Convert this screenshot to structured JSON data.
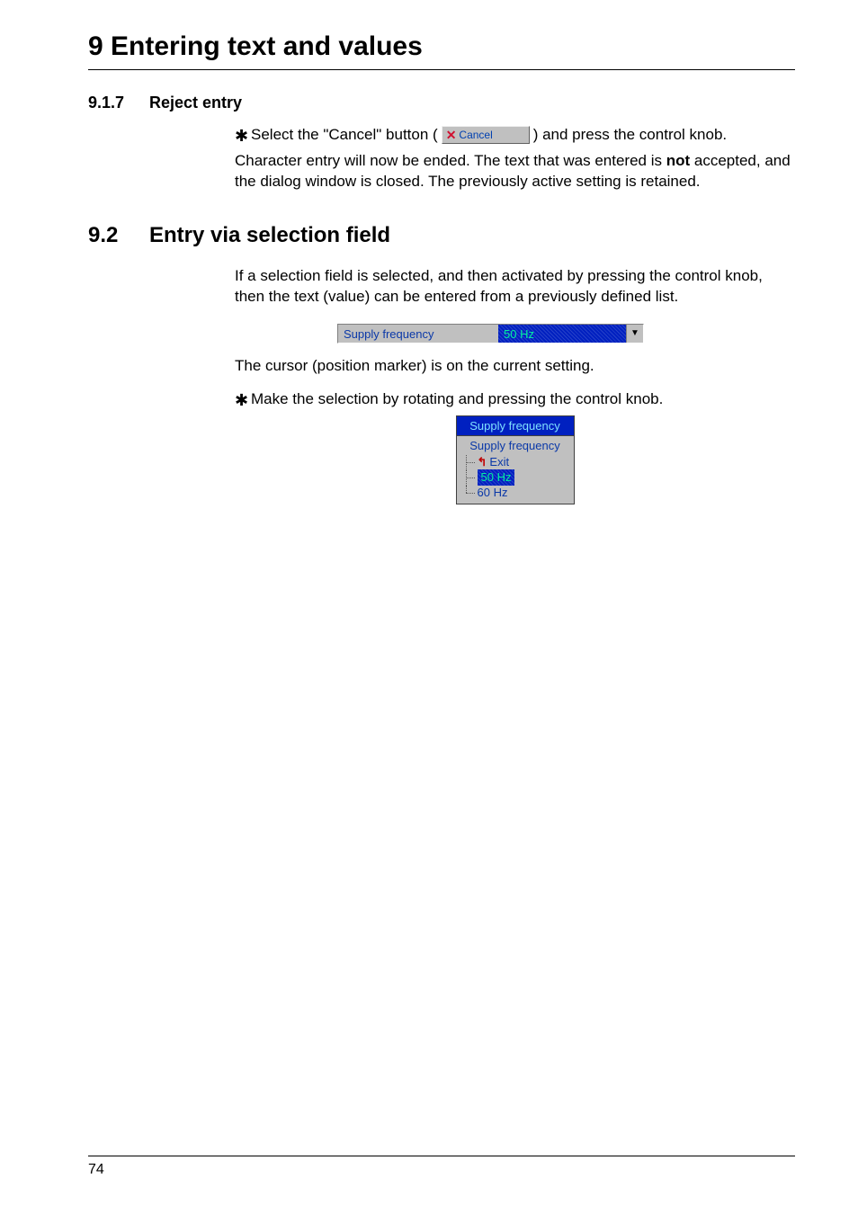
{
  "chapter": {
    "title": "9 Entering text and values"
  },
  "section_917": {
    "number": "9.1.7",
    "title": "Reject entry",
    "bullet_pre": "Select the \"Cancel\" button (",
    "cancel_label": "Cancel",
    "bullet_post": ") and press the control knob.",
    "para_a": "Character entry will now be ended. The text that was entered is ",
    "para_b_bold": "not",
    "para_c": " accepted, and the dialog window is closed. The previously active setting is retained."
  },
  "section_92": {
    "number": "9.2",
    "title": "Entry via selection field",
    "intro": "If a selection field is selected, and then activated by pressing the control knob, then the text (value) can be entered from a previously defined list.",
    "select": {
      "label": "Supply frequency",
      "value": "50 Hz"
    },
    "cursor_line": "The cursor (position marker) is on the current setting.",
    "bullet": "Make the selection by rotating and pressing the control knob.",
    "dropdown": {
      "title": "Supply frequency",
      "subtitle": "Supply frequency",
      "exit": "Exit",
      "opt1": "50 Hz",
      "opt2": "60 Hz"
    }
  },
  "page_number": "74"
}
